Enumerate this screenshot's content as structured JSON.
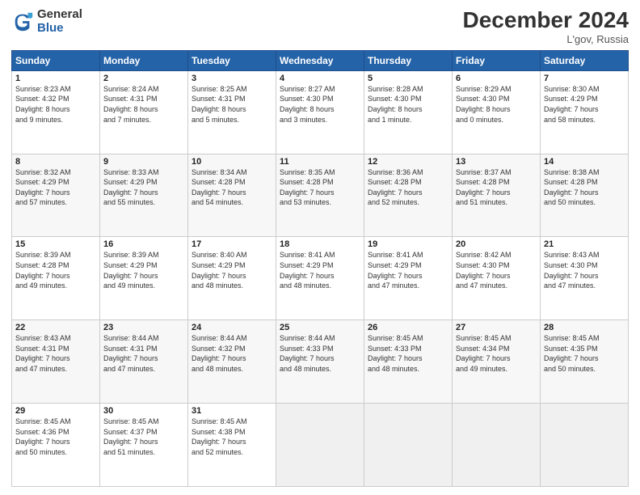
{
  "header": {
    "logo_line1": "General",
    "logo_line2": "Blue",
    "main_title": "December 2024",
    "sub_title": "L'gov, Russia"
  },
  "days_of_week": [
    "Sunday",
    "Monday",
    "Tuesday",
    "Wednesday",
    "Thursday",
    "Friday",
    "Saturday"
  ],
  "weeks": [
    [
      {
        "day": "1",
        "info": "Sunrise: 8:23 AM\nSunset: 4:32 PM\nDaylight: 8 hours\nand 9 minutes."
      },
      {
        "day": "2",
        "info": "Sunrise: 8:24 AM\nSunset: 4:31 PM\nDaylight: 8 hours\nand 7 minutes."
      },
      {
        "day": "3",
        "info": "Sunrise: 8:25 AM\nSunset: 4:31 PM\nDaylight: 8 hours\nand 5 minutes."
      },
      {
        "day": "4",
        "info": "Sunrise: 8:27 AM\nSunset: 4:30 PM\nDaylight: 8 hours\nand 3 minutes."
      },
      {
        "day": "5",
        "info": "Sunrise: 8:28 AM\nSunset: 4:30 PM\nDaylight: 8 hours\nand 1 minute."
      },
      {
        "day": "6",
        "info": "Sunrise: 8:29 AM\nSunset: 4:30 PM\nDaylight: 8 hours\nand 0 minutes."
      },
      {
        "day": "7",
        "info": "Sunrise: 8:30 AM\nSunset: 4:29 PM\nDaylight: 7 hours\nand 58 minutes."
      }
    ],
    [
      {
        "day": "8",
        "info": "Sunrise: 8:32 AM\nSunset: 4:29 PM\nDaylight: 7 hours\nand 57 minutes."
      },
      {
        "day": "9",
        "info": "Sunrise: 8:33 AM\nSunset: 4:29 PM\nDaylight: 7 hours\nand 55 minutes."
      },
      {
        "day": "10",
        "info": "Sunrise: 8:34 AM\nSunset: 4:28 PM\nDaylight: 7 hours\nand 54 minutes."
      },
      {
        "day": "11",
        "info": "Sunrise: 8:35 AM\nSunset: 4:28 PM\nDaylight: 7 hours\nand 53 minutes."
      },
      {
        "day": "12",
        "info": "Sunrise: 8:36 AM\nSunset: 4:28 PM\nDaylight: 7 hours\nand 52 minutes."
      },
      {
        "day": "13",
        "info": "Sunrise: 8:37 AM\nSunset: 4:28 PM\nDaylight: 7 hours\nand 51 minutes."
      },
      {
        "day": "14",
        "info": "Sunrise: 8:38 AM\nSunset: 4:28 PM\nDaylight: 7 hours\nand 50 minutes."
      }
    ],
    [
      {
        "day": "15",
        "info": "Sunrise: 8:39 AM\nSunset: 4:28 PM\nDaylight: 7 hours\nand 49 minutes."
      },
      {
        "day": "16",
        "info": "Sunrise: 8:39 AM\nSunset: 4:29 PM\nDaylight: 7 hours\nand 49 minutes."
      },
      {
        "day": "17",
        "info": "Sunrise: 8:40 AM\nSunset: 4:29 PM\nDaylight: 7 hours\nand 48 minutes."
      },
      {
        "day": "18",
        "info": "Sunrise: 8:41 AM\nSunset: 4:29 PM\nDaylight: 7 hours\nand 48 minutes."
      },
      {
        "day": "19",
        "info": "Sunrise: 8:41 AM\nSunset: 4:29 PM\nDaylight: 7 hours\nand 47 minutes."
      },
      {
        "day": "20",
        "info": "Sunrise: 8:42 AM\nSunset: 4:30 PM\nDaylight: 7 hours\nand 47 minutes."
      },
      {
        "day": "21",
        "info": "Sunrise: 8:43 AM\nSunset: 4:30 PM\nDaylight: 7 hours\nand 47 minutes."
      }
    ],
    [
      {
        "day": "22",
        "info": "Sunrise: 8:43 AM\nSunset: 4:31 PM\nDaylight: 7 hours\nand 47 minutes."
      },
      {
        "day": "23",
        "info": "Sunrise: 8:44 AM\nSunset: 4:31 PM\nDaylight: 7 hours\nand 47 minutes."
      },
      {
        "day": "24",
        "info": "Sunrise: 8:44 AM\nSunset: 4:32 PM\nDaylight: 7 hours\nand 48 minutes."
      },
      {
        "day": "25",
        "info": "Sunrise: 8:44 AM\nSunset: 4:33 PM\nDaylight: 7 hours\nand 48 minutes."
      },
      {
        "day": "26",
        "info": "Sunrise: 8:45 AM\nSunset: 4:33 PM\nDaylight: 7 hours\nand 48 minutes."
      },
      {
        "day": "27",
        "info": "Sunrise: 8:45 AM\nSunset: 4:34 PM\nDaylight: 7 hours\nand 49 minutes."
      },
      {
        "day": "28",
        "info": "Sunrise: 8:45 AM\nSunset: 4:35 PM\nDaylight: 7 hours\nand 50 minutes."
      }
    ],
    [
      {
        "day": "29",
        "info": "Sunrise: 8:45 AM\nSunset: 4:36 PM\nDaylight: 7 hours\nand 50 minutes."
      },
      {
        "day": "30",
        "info": "Sunrise: 8:45 AM\nSunset: 4:37 PM\nDaylight: 7 hours\nand 51 minutes."
      },
      {
        "day": "31",
        "info": "Sunrise: 8:45 AM\nSunset: 4:38 PM\nDaylight: 7 hours\nand 52 minutes."
      },
      {
        "day": "",
        "info": ""
      },
      {
        "day": "",
        "info": ""
      },
      {
        "day": "",
        "info": ""
      },
      {
        "day": "",
        "info": ""
      }
    ]
  ]
}
